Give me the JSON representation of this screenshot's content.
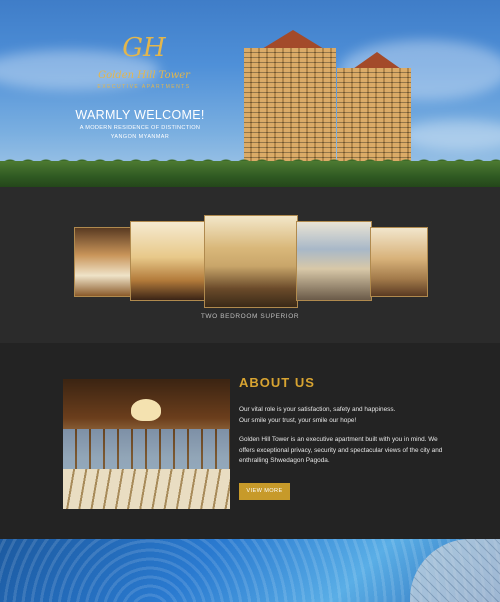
{
  "hero": {
    "logo_mark": "GH",
    "logo_name": "Golden Hill Tower",
    "logo_sub": "EXECUTIVE APARTMENTS",
    "heading": "WARMLY WELCOME!",
    "tagline": "A MODERN RESIDENCE OF DISTINCTION",
    "location": "YANGON MYANMAR"
  },
  "gallery": {
    "caption": "TWO BEDROOM SUPERIOR",
    "photos": [
      "bedroom",
      "living-room",
      "lounge",
      "dining-room",
      "sitting-room"
    ]
  },
  "about": {
    "heading": "ABOUT US",
    "paragraph1_line1": "Our vital role is your satisfaction, safety and happiness.",
    "paragraph1_line2": "Our smile your trust, your smile our hope!",
    "paragraph2": "Golden Hill Tower is an executive apartment built with you in mind. We offers exceptional privacy, security and spectacular views of the city and enthralling Shwedagon Pagoda.",
    "button_label": "VIEW MORE"
  },
  "colors": {
    "accent": "#d8a431",
    "button": "#c79a2a",
    "dark_bg": "#232323",
    "gallery_bg": "#2b2b2b"
  }
}
